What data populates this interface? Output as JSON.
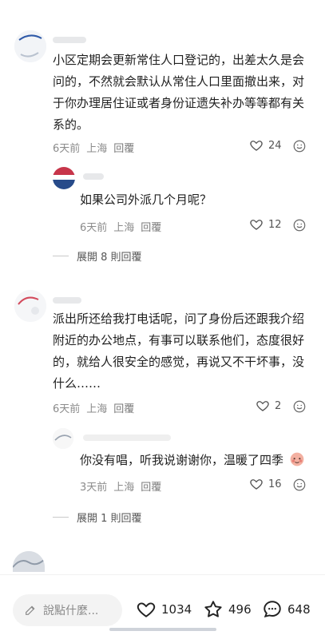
{
  "comments": [
    {
      "text": "小区定期会更新常住人口登记的，出差太久是会问的，不然就会默认从常住人口里面撤出来，对于你办理居住证或者身份证遗失补办等等都有关系的。",
      "time": "6天前",
      "location": "上海",
      "reply_label": "回覆",
      "likes": "24",
      "replies": [
        {
          "text": "如果公司外派几个月呢？",
          "time": "6天前",
          "location": "上海",
          "reply_label": "回覆",
          "likes": "12"
        }
      ],
      "expand_label": "展開 8 則回覆"
    },
    {
      "text": "派出所还给我打电话呢，问了身份后还跟我介绍附近的办公地点，有事可以联系他们，态度很好的，就给人很安全的感觉，再说又不干坏事，没什么……",
      "time": "6天前",
      "location": "上海",
      "reply_label": "回覆",
      "likes": "2",
      "replies": [
        {
          "text": "你没有唱，听我说谢谢你，温暖了四季",
          "time": "3天前",
          "location": "上海",
          "reply_label": "回覆",
          "likes": "16"
        }
      ],
      "expand_label": "展開 1 則回覆"
    }
  ],
  "bottom_bar": {
    "input_placeholder": "說點什麼...",
    "likes": "1034",
    "favorites": "496",
    "comments": "648"
  }
}
